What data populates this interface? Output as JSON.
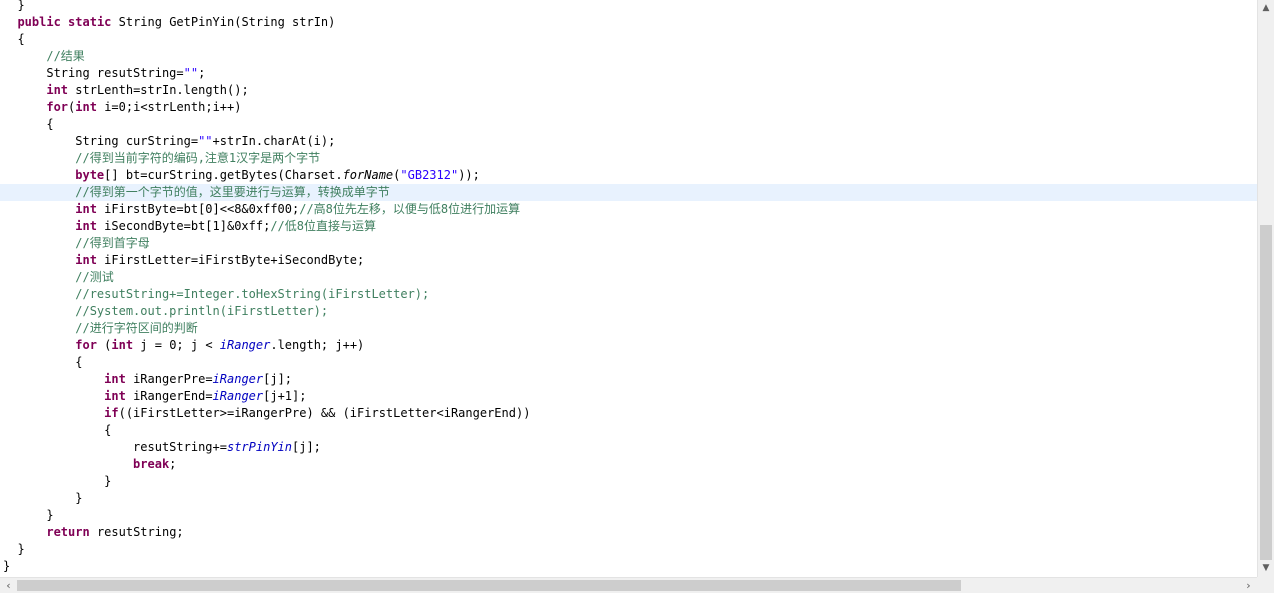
{
  "editor": {
    "language": "java",
    "current_line_index": 11,
    "colors": {
      "keyword": "#7f0055",
      "comment": "#3f7f5f",
      "string": "#2a00ff",
      "field": "#0000c0",
      "current_line_bg": "#e8f2fe"
    },
    "lines": [
      [
        {
          "t": "  }"
        }
      ],
      [
        {
          "t": "  "
        },
        {
          "t": "public",
          "c": "kw"
        },
        {
          "t": " "
        },
        {
          "t": "static",
          "c": "kw"
        },
        {
          "t": " String GetPinYin(String strIn)"
        }
      ],
      [
        {
          "t": "  {"
        }
      ],
      [
        {
          "t": "      "
        },
        {
          "t": "//结果",
          "c": "cm"
        }
      ],
      [
        {
          "t": "      String resutString="
        },
        {
          "t": "\"\"",
          "c": "st"
        },
        {
          "t": ";"
        }
      ],
      [
        {
          "t": "      "
        },
        {
          "t": "int",
          "c": "kw"
        },
        {
          "t": " strLenth=strIn.length();"
        }
      ],
      [
        {
          "t": "      "
        },
        {
          "t": "for",
          "c": "kw"
        },
        {
          "t": "("
        },
        {
          "t": "int",
          "c": "kw"
        },
        {
          "t": " i=0;i<strLenth;i++)"
        }
      ],
      [
        {
          "t": "      {"
        }
      ],
      [
        {
          "t": "          String curString="
        },
        {
          "t": "\"\"",
          "c": "st"
        },
        {
          "t": "+strIn.charAt(i);"
        }
      ],
      [
        {
          "t": "          "
        },
        {
          "t": "//得到当前字符的编码,注意1汉字是两个字节",
          "c": "cm"
        }
      ],
      [
        {
          "t": "          "
        },
        {
          "t": "byte",
          "c": "kw"
        },
        {
          "t": "[] bt=curString.getBytes(Charset."
        },
        {
          "t": "forName",
          "c": "it"
        },
        {
          "t": "("
        },
        {
          "t": "\"GB2312\"",
          "c": "st"
        },
        {
          "t": "));"
        }
      ],
      [
        {
          "t": "          "
        },
        {
          "t": "//得到第一个字节的值，这里要进行与运算，转换成单字节",
          "c": "cm"
        }
      ],
      [
        {
          "t": "          "
        },
        {
          "t": "int",
          "c": "kw"
        },
        {
          "t": " iFirstByte=bt[0]<<8&0xff00;"
        },
        {
          "t": "//高8位先左移，以便与低8位进行加运算",
          "c": "cm"
        }
      ],
      [
        {
          "t": "          "
        },
        {
          "t": "int",
          "c": "kw"
        },
        {
          "t": " iSecondByte=bt[1]&0xff;"
        },
        {
          "t": "//低8位直接与运算",
          "c": "cm"
        }
      ],
      [
        {
          "t": "          "
        },
        {
          "t": "//得到首字母",
          "c": "cm"
        }
      ],
      [
        {
          "t": "          "
        },
        {
          "t": "int",
          "c": "kw"
        },
        {
          "t": " iFirstLetter=iFirstByte+iSecondByte;"
        }
      ],
      [
        {
          "t": "          "
        },
        {
          "t": "//测试",
          "c": "cm"
        }
      ],
      [
        {
          "t": "          "
        },
        {
          "t": "//resutString+=Integer.toHexString(iFirstLetter);",
          "c": "cm"
        }
      ],
      [
        {
          "t": "          "
        },
        {
          "t": "//System.out.println(iFirstLetter);",
          "c": "cm"
        }
      ],
      [
        {
          "t": "          "
        },
        {
          "t": "//进行字符区间的判断",
          "c": "cm"
        }
      ],
      [
        {
          "t": "          "
        },
        {
          "t": "for",
          "c": "kw"
        },
        {
          "t": " ("
        },
        {
          "t": "int",
          "c": "kw"
        },
        {
          "t": " j = 0; j < "
        },
        {
          "t": "iRanger",
          "c": "fld"
        },
        {
          "t": ".length; j++)"
        }
      ],
      [
        {
          "t": "          {"
        }
      ],
      [
        {
          "t": "              "
        },
        {
          "t": "int",
          "c": "kw"
        },
        {
          "t": " iRangerPre="
        },
        {
          "t": "iRanger",
          "c": "fld"
        },
        {
          "t": "[j];"
        }
      ],
      [
        {
          "t": "              "
        },
        {
          "t": "int",
          "c": "kw"
        },
        {
          "t": " iRangerEnd="
        },
        {
          "t": "iRanger",
          "c": "fld"
        },
        {
          "t": "[j+1];"
        }
      ],
      [
        {
          "t": "              "
        },
        {
          "t": "if",
          "c": "kw"
        },
        {
          "t": "((iFirstLetter>=iRangerPre) && (iFirstLetter<iRangerEnd))"
        }
      ],
      [
        {
          "t": "              {"
        }
      ],
      [
        {
          "t": "                  resutString+="
        },
        {
          "t": "strPinYin",
          "c": "fld"
        },
        {
          "t": "[j];"
        }
      ],
      [
        {
          "t": "                  "
        },
        {
          "t": "break",
          "c": "kw"
        },
        {
          "t": ";"
        }
      ],
      [
        {
          "t": "              }"
        }
      ],
      [
        {
          "t": "          }"
        }
      ],
      [
        {
          "t": "      }"
        }
      ],
      [
        {
          "t": "      "
        },
        {
          "t": "return",
          "c": "kw"
        },
        {
          "t": " resutString;"
        }
      ],
      [
        {
          "t": "  }"
        }
      ],
      [
        {
          "t": "}"
        }
      ]
    ]
  },
  "scrollbars": {
    "vertical": {
      "up_arrow": "▲",
      "down_arrow": "▼"
    },
    "horizontal": {
      "left_arrow": "‹",
      "right_arrow": "›"
    }
  }
}
